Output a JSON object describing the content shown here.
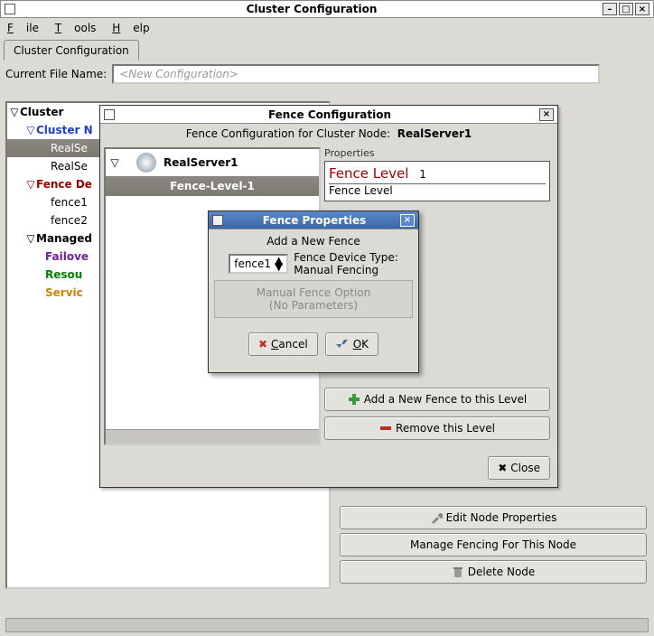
{
  "window": {
    "title": "Cluster Configuration",
    "menu": {
      "file": "File",
      "tools": "Tools",
      "help": "Help"
    },
    "tab": "Cluster Configuration",
    "filename_label": "Current File Name:",
    "filename_placeholder": "<New Configuration>"
  },
  "tree": {
    "root": "Cluster",
    "cluster_nodes": "Cluster N",
    "node1": "RealSe",
    "node2": "RealSe",
    "fence_devices": "Fence De",
    "fence1": "fence1",
    "fence2": "fence2",
    "managed": "Managed",
    "failover": "Failove",
    "resources": "Resou",
    "services": "Servic"
  },
  "fence_dialog": {
    "title": "Fence Configuration",
    "heading": "Fence Configuration for Cluster Node:",
    "node": "RealServer1",
    "tree_node": "RealServer1",
    "tree_level": "Fence-Level-1",
    "props_label": "Properties",
    "level_label": "Fence Level",
    "level_num": "1",
    "sub_label": "Fence Level",
    "add_btn": "Add a New Fence to this Level",
    "remove_btn": "Remove this Level",
    "close_btn": "Close"
  },
  "props_dialog": {
    "title": "Fence Properties",
    "heading": "Add a New Fence",
    "select": "fence1",
    "type_label": "Fence Device Type:",
    "type_value": "Manual Fencing",
    "manual_opt1": "Manual Fence Option",
    "manual_opt2": "(No Parameters)",
    "cancel": "Cancel",
    "ok": "OK"
  },
  "bottom": {
    "edit": "Edit Node Properties",
    "manage": "Manage Fencing For This Node",
    "delete": "Delete Node"
  }
}
